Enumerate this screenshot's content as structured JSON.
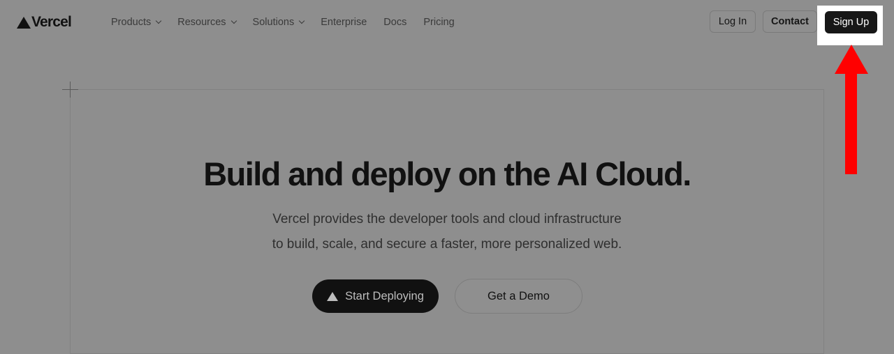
{
  "header": {
    "logo_text": "Vercel",
    "nav": [
      {
        "label": "Products",
        "has_dropdown": true
      },
      {
        "label": "Resources",
        "has_dropdown": true
      },
      {
        "label": "Solutions",
        "has_dropdown": true
      },
      {
        "label": "Enterprise",
        "has_dropdown": false
      },
      {
        "label": "Docs",
        "has_dropdown": false
      },
      {
        "label": "Pricing",
        "has_dropdown": false
      }
    ],
    "login_label": "Log In",
    "contact_label": "Contact",
    "signup_label": "Sign Up"
  },
  "hero": {
    "headline": "Build and deploy on the AI Cloud.",
    "subtext_line1": "Vercel provides the developer tools and cloud infrastructure",
    "subtext_line2": "to build, scale, and secure a faster, more personalized web.",
    "primary_cta": "Start Deploying",
    "secondary_cta": "Get a Demo"
  },
  "annotation": {
    "arrow_color": "#ff0000",
    "highlight_color": "#ffffff",
    "target": "signup-button"
  },
  "colors": {
    "overlay_background": "#8e8e8e",
    "primary_button": "#171717"
  }
}
